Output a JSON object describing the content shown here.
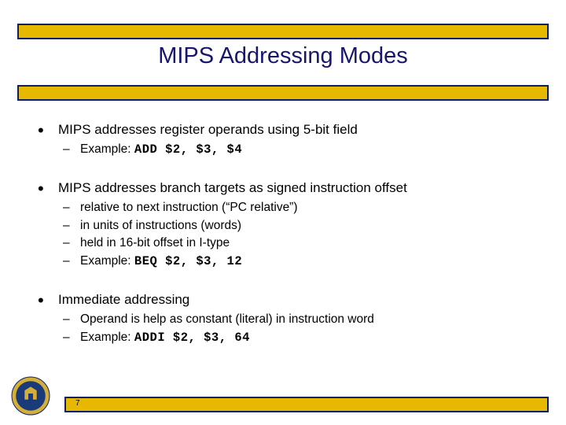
{
  "title": "MIPS Addressing Modes",
  "bullets": [
    {
      "heading": "MIPS addresses register operands using 5-bit field",
      "subs": [
        {
          "text": "Example: ",
          "code": "ADD $2, $3, $4"
        }
      ]
    },
    {
      "heading": "MIPS addresses branch targets as signed instruction offset",
      "subs": [
        {
          "text": "relative to next instruction (“PC relative”)",
          "code": ""
        },
        {
          "text": "in units of instructions (words)",
          "code": ""
        },
        {
          "text": "held in 16-bit offset in I-type",
          "code": ""
        },
        {
          "text": "Example: ",
          "code": "BEQ $2, $3, 12"
        }
      ]
    },
    {
      "heading": "Immediate addressing",
      "subs": [
        {
          "text": "Operand is help as constant (literal) in instruction word",
          "code": ""
        },
        {
          "text": "Example: ",
          "code": "ADDI $2, $3, 64"
        }
      ]
    }
  ],
  "page_number": "7"
}
